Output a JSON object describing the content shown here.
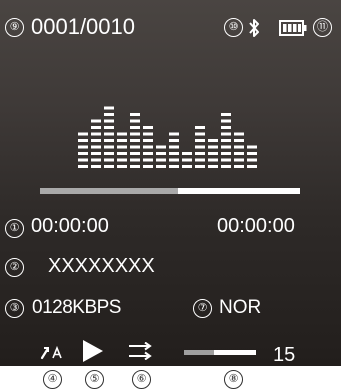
{
  "status_bar": {
    "track_counter": "0001/0010",
    "bluetooth_icon": "bluetooth-icon",
    "battery_icon": "battery-icon",
    "battery_level": 1.0
  },
  "callouts": [
    "①",
    "②",
    "③",
    "④",
    "⑤",
    "⑥",
    "⑦",
    "⑧",
    "⑨",
    "⑩",
    "⑪"
  ],
  "spectrum": {
    "icon": "equalizer-spectrum-icon",
    "bar_levels": [
      6,
      8,
      10,
      6,
      9,
      7,
      4,
      6,
      3,
      7,
      5,
      9,
      6,
      4
    ]
  },
  "playback": {
    "progress": 0.53,
    "elapsed_time": "00:00:00",
    "total_time": "00:00:00"
  },
  "track": {
    "title": "XXXXXXXX",
    "bitrate": "0128KBPS",
    "eq_mode": "NOR"
  },
  "controls": {
    "sound_effect_icon": "sound-effect-icon",
    "play_icon": "play-icon",
    "repeat_mode_icon": "repeat-sequential-icon",
    "volume_level": 0.42,
    "volume_value": "15"
  },
  "colors": {
    "foreground": "#ffffff",
    "progress_played": "#a9a9a9",
    "screen_top": "#4a4542",
    "screen_bottom": "#221e1c"
  }
}
